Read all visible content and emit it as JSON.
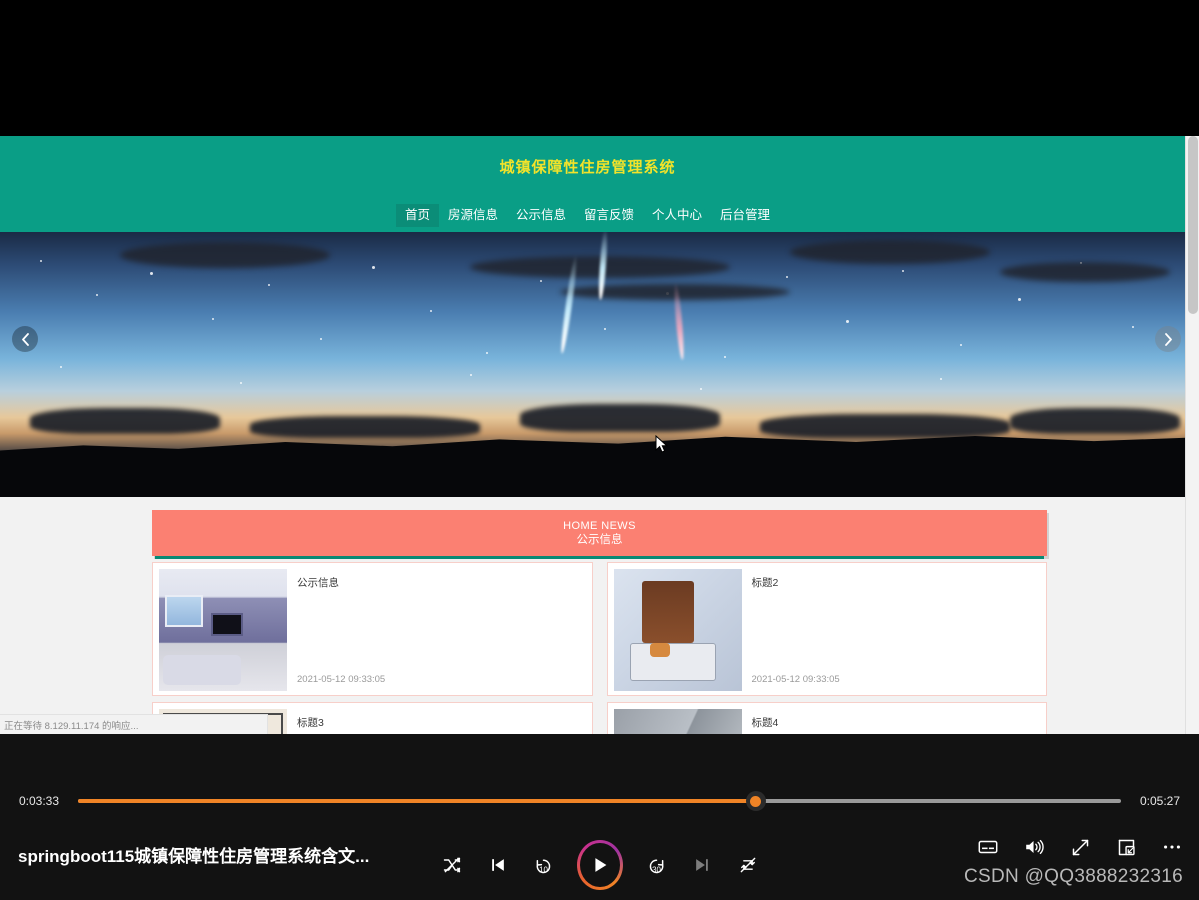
{
  "site": {
    "title": "城镇保障性住房管理系统",
    "nav": [
      {
        "label": "首页",
        "active": true
      },
      {
        "label": "房源信息",
        "active": false
      },
      {
        "label": "公示信息",
        "active": false
      },
      {
        "label": "留言反馈",
        "active": false
      },
      {
        "label": "个人中心",
        "active": false
      },
      {
        "label": "后台管理",
        "active": false
      }
    ],
    "carousel": {
      "prev_icon": "chevron-left-icon",
      "next_icon": "chevron-right-icon"
    },
    "news": {
      "banner_en": "HOME NEWS",
      "banner_cn": "公示信息",
      "cards": [
        {
          "title": "公示信息",
          "date": "2021-05-12 09:33:05",
          "thumb": "livingroom"
        },
        {
          "title": "标题2",
          "date": "2021-05-12 09:33:05",
          "thumb": "bedroom"
        },
        {
          "title": "标题3",
          "date": "",
          "thumb": "floorplan"
        },
        {
          "title": "标题4",
          "date": "",
          "thumb": "gray"
        }
      ]
    },
    "status_text": "正在等待 8.129.11.174 的响应...",
    "colors": {
      "header_green": "#0a9e86",
      "title_yellow": "#f2e32a",
      "banner_salmon": "#fb8072"
    }
  },
  "player": {
    "video_title": "springboot115城镇保障性住房管理系统含文...",
    "current_time": "0:03:33",
    "total_time": "0:05:27",
    "progress_percent": 65,
    "transport": {
      "shuffle": "shuffle-off-icon",
      "previous": "previous-track-icon",
      "rewind10": "rewind-10-icon",
      "play": "play-icon",
      "forward30": "forward-30-icon",
      "next": "next-track-icon",
      "repeat": "repeat-off-icon"
    },
    "right_controls": {
      "subtitles": "subtitles-icon",
      "volume": "volume-icon",
      "fullscreen": "fullscreen-icon",
      "miniplayer": "picture-in-picture-icon",
      "more": "more-options-icon"
    },
    "watermark": "CSDN @QQ3888232316",
    "accent_color": "#f08426"
  }
}
